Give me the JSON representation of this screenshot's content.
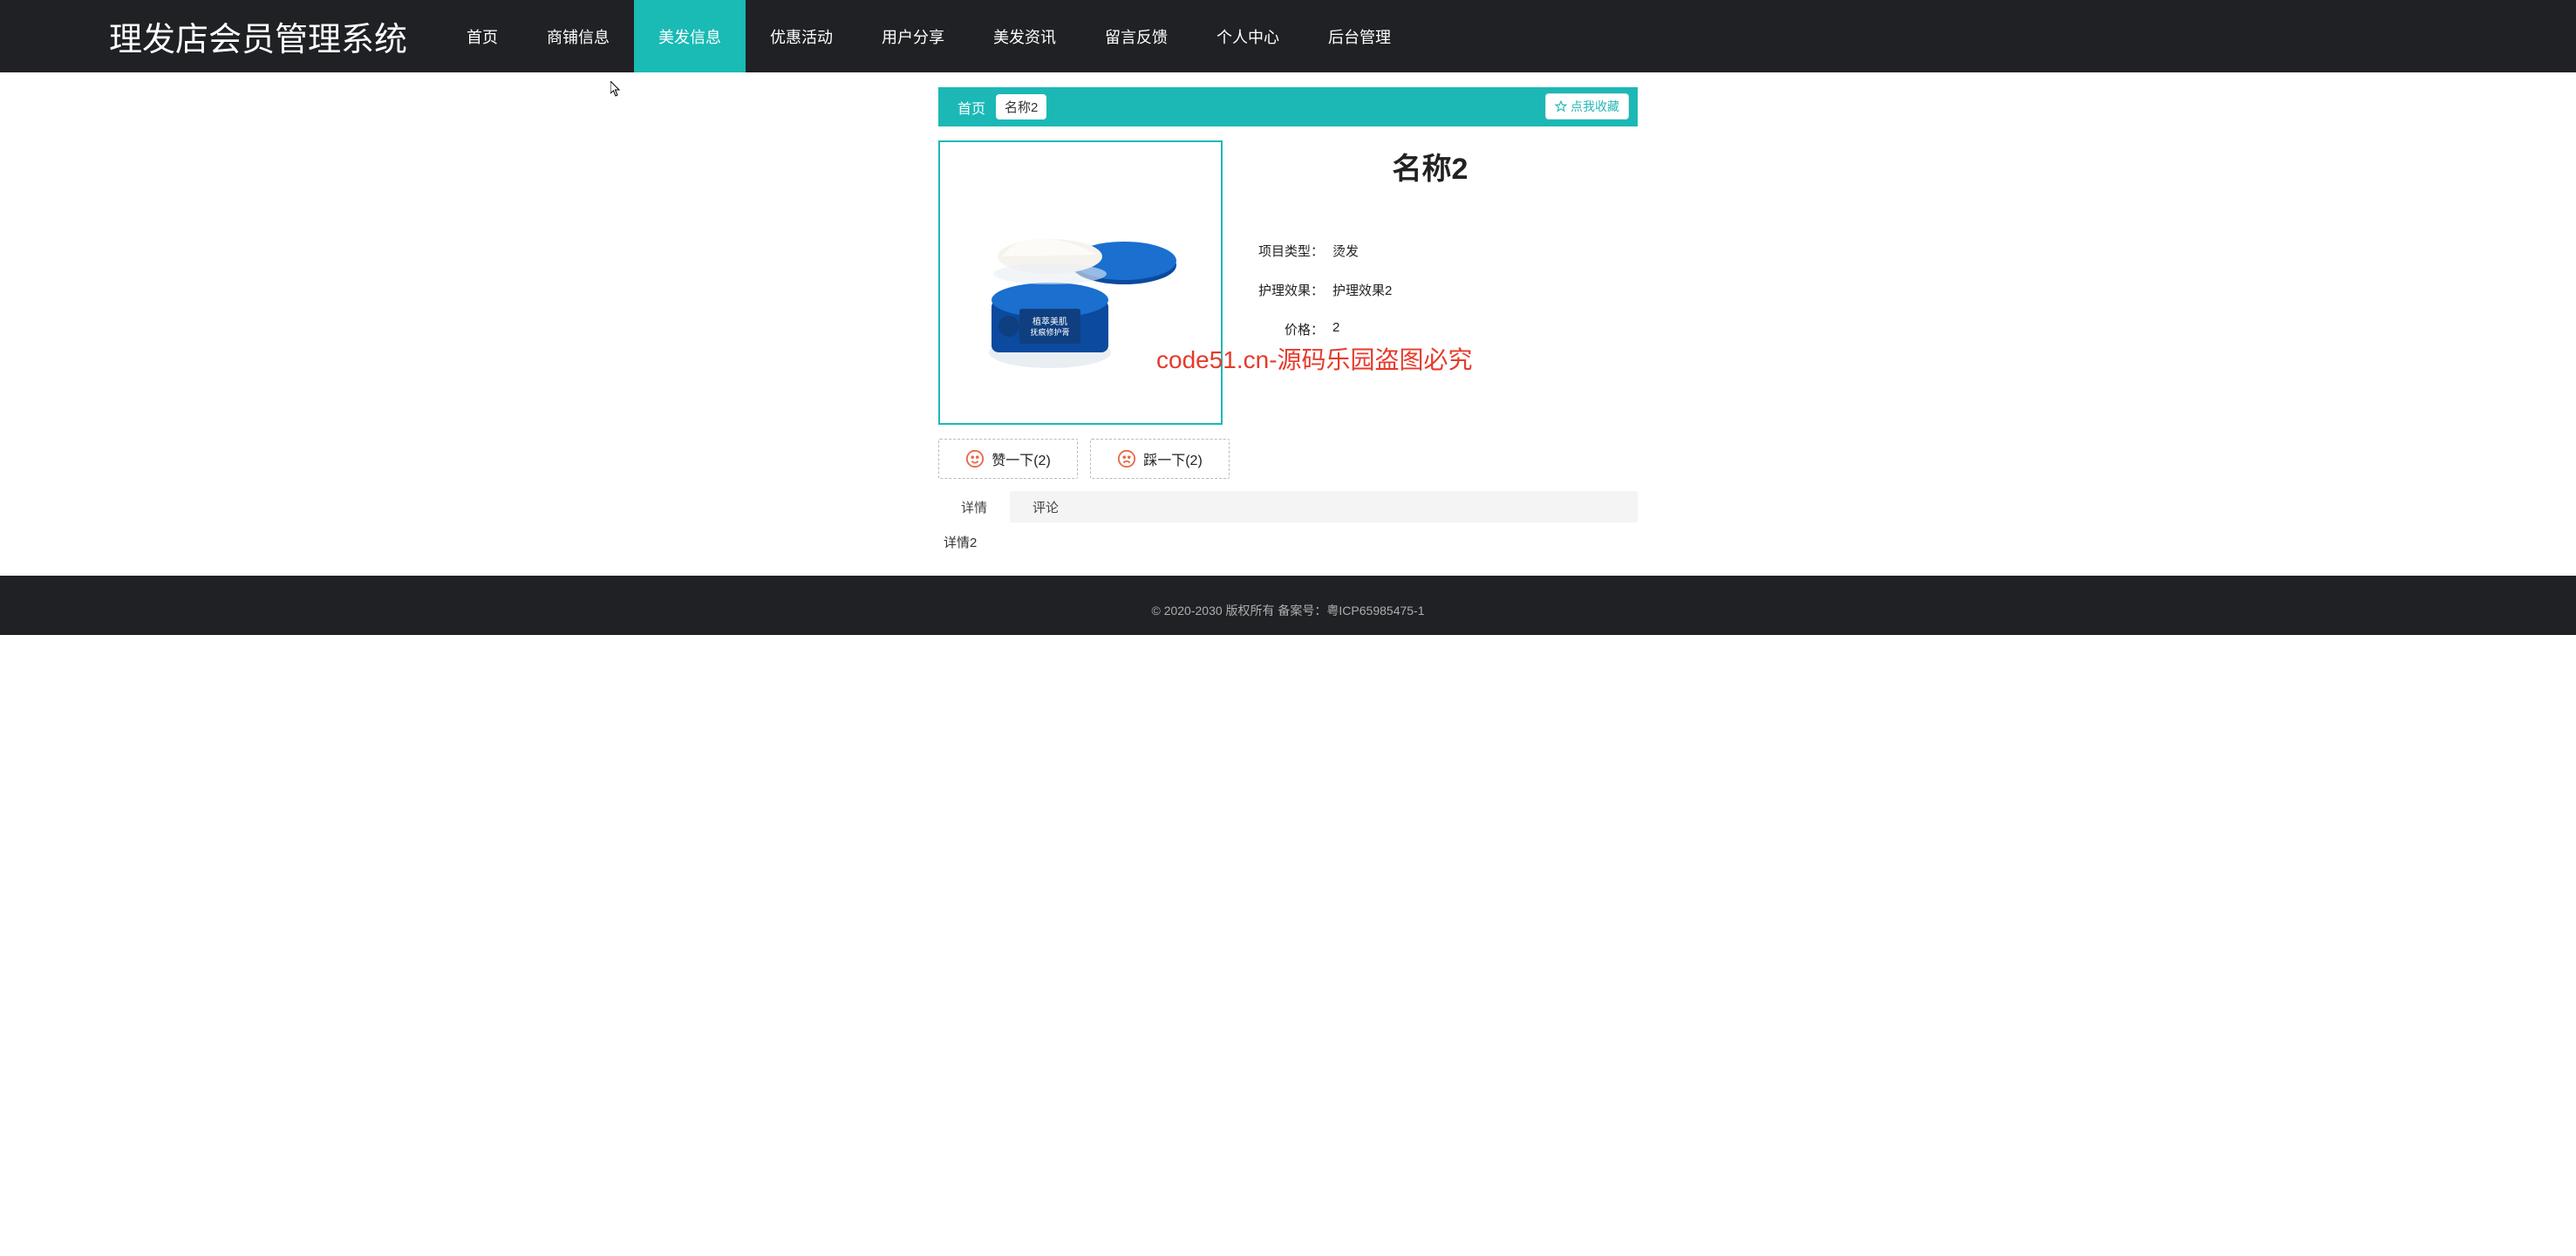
{
  "watermark_text": "code51.cn",
  "header": {
    "logo": "理发店会员管理系统",
    "nav": [
      "首页",
      "商铺信息",
      "美发信息",
      "优惠活动",
      "用户分享",
      "美发资讯",
      "留言反馈",
      "个人中心",
      "后台管理"
    ],
    "active_index": 2
  },
  "breadcrumb": {
    "home": "首页",
    "current": "名称2",
    "favorite_label": "点我收藏"
  },
  "detail": {
    "title": "名称2",
    "rows": [
      {
        "label": "项目类型",
        "value": "烫发"
      },
      {
        "label": "护理效果",
        "value": "护理效果2"
      },
      {
        "label": "价格",
        "value": "2"
      }
    ]
  },
  "overlay_watermark": "code51.cn-源码乐园盗图必究",
  "vote": {
    "like_label": "赞一下(2)",
    "dislike_label": "踩一下(2)"
  },
  "tabs": {
    "items": [
      "详情",
      "评论"
    ],
    "active_index": 0,
    "content": "详情2"
  },
  "footer": {
    "text": "© 2020-2030 版权所有 备案号：粤ICP65985475-1"
  }
}
